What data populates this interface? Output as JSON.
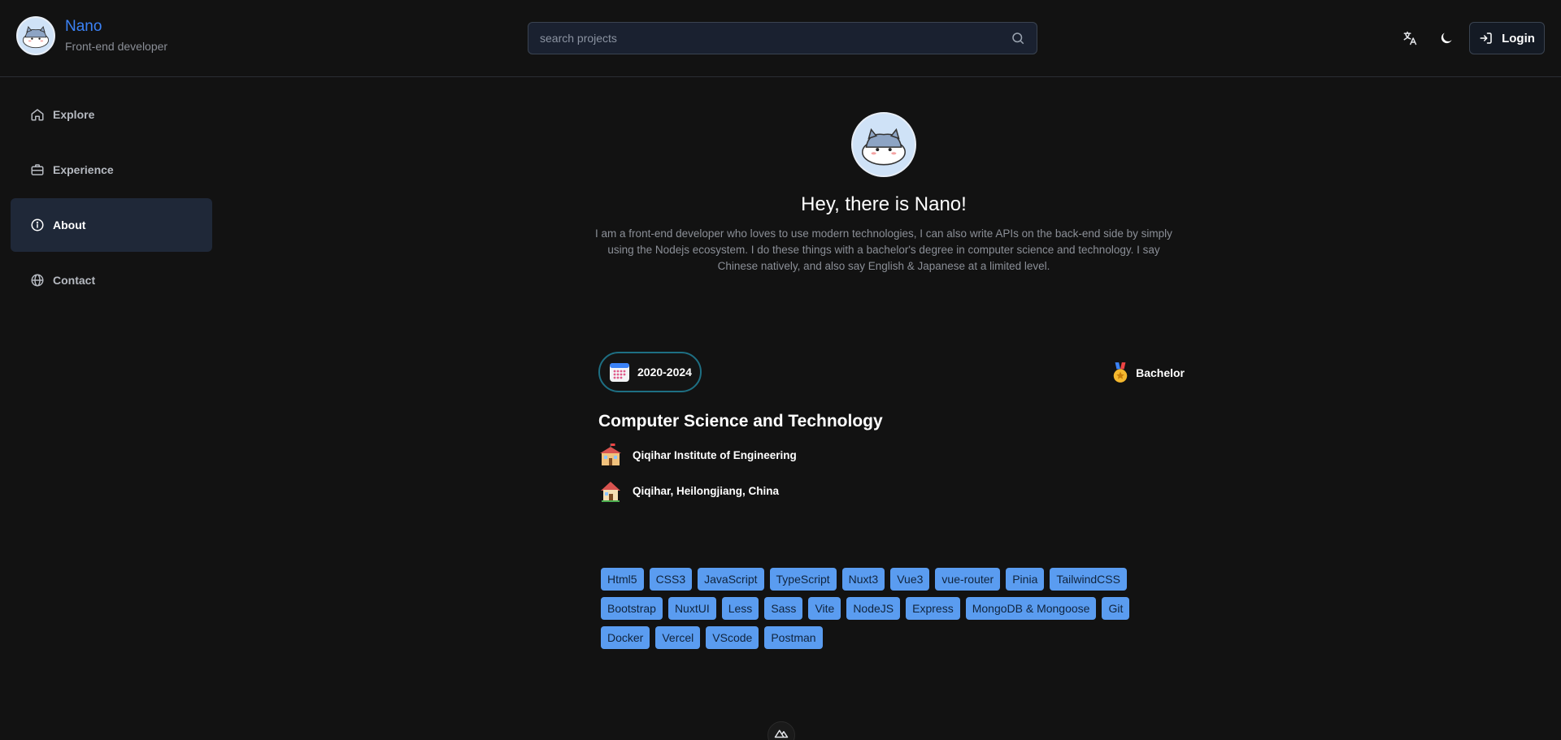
{
  "header": {
    "name": "Nano",
    "role": "Front-end developer",
    "search_placeholder": "search projects",
    "login_label": "Login",
    "icons": [
      "translate-icon",
      "moon-icon",
      "login-icon"
    ]
  },
  "sidebar": {
    "items": [
      {
        "label": "Explore",
        "icon": "home-icon",
        "active": false
      },
      {
        "label": "Experience",
        "icon": "briefcase-icon",
        "active": false
      },
      {
        "label": "About",
        "icon": "info-icon",
        "active": true
      },
      {
        "label": "Contact",
        "icon": "globe-icon",
        "active": false
      }
    ]
  },
  "profile": {
    "greeting": "Hey, there is Nano!",
    "bio": "I am a front-end developer who loves to use modern technologies, I can also write APIs on the back-end side by simply using the Nodejs ecosystem. I do these things with a bachelor's degree in computer science and technology. I say Chinese natively, and also say English & Japanese at a limited level."
  },
  "education": {
    "years": "2020-2024",
    "degree": "Bachelor",
    "major": "Computer Science and Technology",
    "school": "Qiqihar Institute of Engineering",
    "location": "Qiqihar, Heilongjiang, China"
  },
  "skills": [
    "Html5",
    "CSS3",
    "JavaScript",
    "TypeScript",
    "Nuxt3",
    "Vue3",
    "vue-router",
    "Pinia",
    "TailwindCSS",
    "Bootstrap",
    "NuxtUI",
    "Less",
    "Sass",
    "Vite",
    "NodeJS",
    "Express",
    "MongoDB & Mongoose",
    "Git",
    "Docker",
    "Vercel",
    "VScode",
    "Postman"
  ],
  "colors": {
    "background": "#121212",
    "accent": "#3b82f6",
    "tag": "#5a9cf0",
    "active_nav": "#1f2838"
  }
}
